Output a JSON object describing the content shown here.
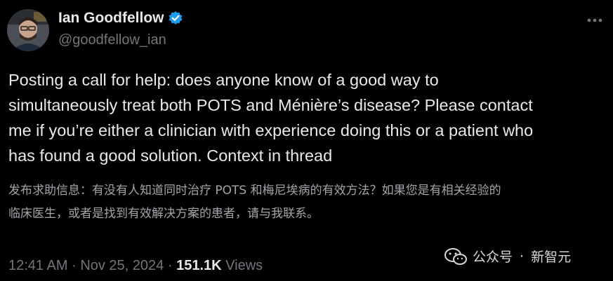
{
  "author": {
    "display_name": "Ian Goodfellow",
    "handle": "@goodfellow_ian",
    "verified": true
  },
  "tweet": {
    "text": "Posting a call for help: does anyone know of a good way to\nsimultaneously treat both POTS and Ménière’s disease? Please contact\nme if you’re either a clinician with experience doing this or a patient who\nhas found a good solution. Context in thread",
    "translation": "发布求助信息：有没有人知道同时治疗 POTS 和梅尼埃病的有效方法？如果您是有相关经验的\n临床医生，或者是找到有效解决方案的患者，请与我联系。"
  },
  "meta": {
    "time": "12:41 AM",
    "separator": "·",
    "date": "Nov 25, 2024",
    "views_count": "151.1K",
    "views_label": "Views"
  },
  "watermark": {
    "account": "公众号",
    "dot": "·",
    "name": "新智元"
  },
  "colors": {
    "background": "#000000",
    "primary_text": "#e7e9ea",
    "secondary_text": "#71767b",
    "verified_badge": "#1d9bf0"
  },
  "icons": {
    "verified": "verified-badge-icon",
    "more": "more-options-icon",
    "watermark": "wechat-icon"
  }
}
